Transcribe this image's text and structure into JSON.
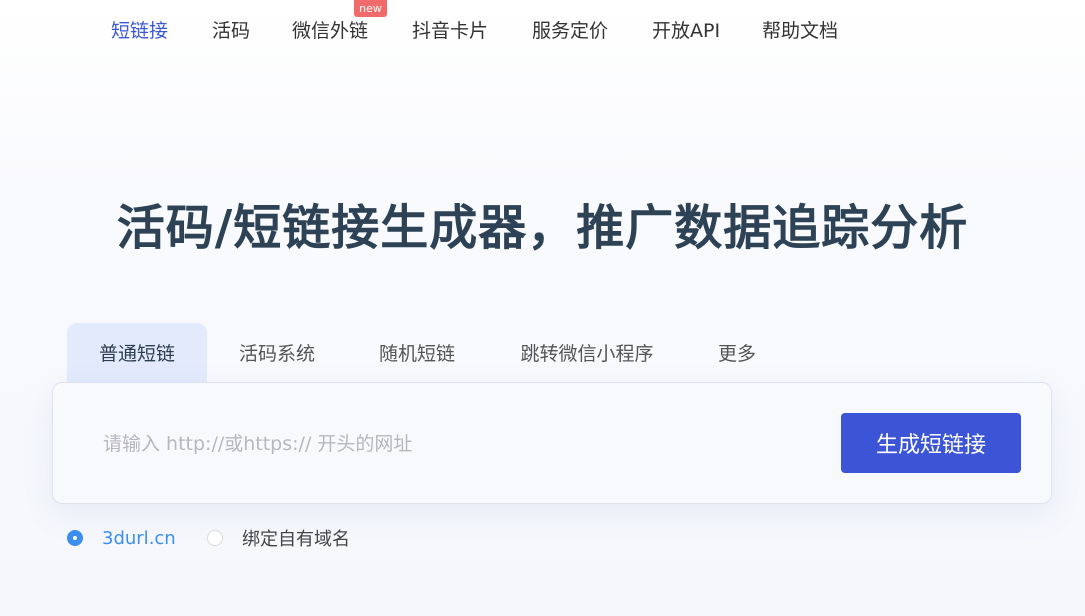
{
  "nav": {
    "items": [
      {
        "label": "短链接",
        "active": true
      },
      {
        "label": "活码",
        "active": false
      },
      {
        "label": "微信外链",
        "active": false,
        "badge": "new"
      },
      {
        "label": "抖音卡片",
        "active": false
      },
      {
        "label": "服务定价",
        "active": false
      },
      {
        "label": "开放API",
        "active": false
      },
      {
        "label": "帮助文档",
        "active": false
      }
    ]
  },
  "hero": {
    "title": "活码/短链接生成器，推广数据追踪分析"
  },
  "tabs": [
    {
      "label": "普通短链",
      "active": true
    },
    {
      "label": "活码系统",
      "active": false
    },
    {
      "label": "随机短链",
      "active": false
    },
    {
      "label": "跳转微信小程序",
      "active": false
    },
    {
      "label": "更多",
      "active": false
    }
  ],
  "form": {
    "url_placeholder": "请输入 http://或https:// 开头的网址",
    "url_value": "",
    "submit_label": "生成短链接"
  },
  "domain_options": [
    {
      "label": "3durl.cn",
      "checked": true
    },
    {
      "label": "绑定自有域名",
      "checked": false
    }
  ],
  "colors": {
    "accent": "#3b55d6",
    "nav_active": "#3a57d6",
    "radio_selected": "#3b8ef0",
    "badge": "#f26b6b",
    "hero_text": "#2e4256"
  }
}
